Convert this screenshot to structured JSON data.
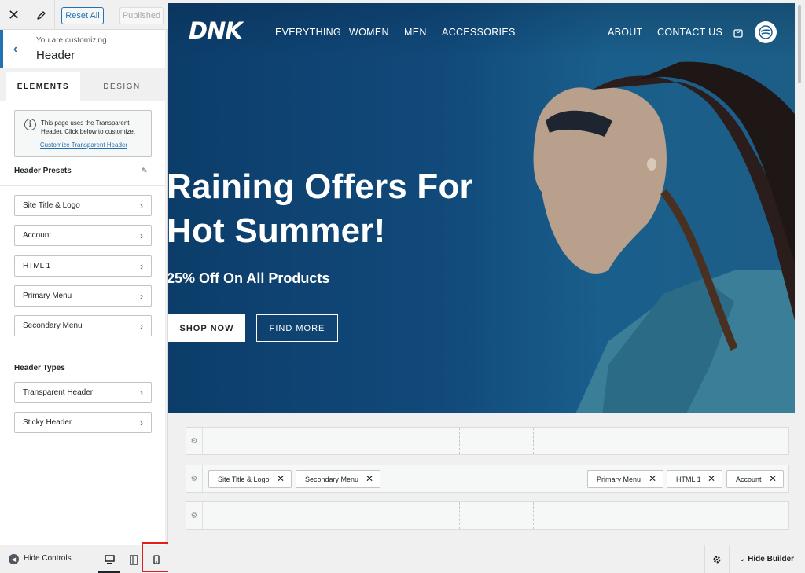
{
  "topbar": {
    "reset_label": "Reset All",
    "published_label": "Published"
  },
  "crumb": {
    "subtitle": "You are customizing",
    "title": "Header"
  },
  "tabs": [
    {
      "label": "ELEMENTS"
    },
    {
      "label": "DESIGN"
    }
  ],
  "notice": {
    "text": "This page uses the Transparent Header. Click below to customize.",
    "link": "Customize Transparent Header"
  },
  "presets": {
    "title": "Header Presets",
    "items": [
      {
        "label": "Site Title & Logo"
      },
      {
        "label": "Account"
      },
      {
        "label": "HTML 1"
      },
      {
        "label": "Primary Menu"
      },
      {
        "label": "Secondary Menu"
      }
    ]
  },
  "types": {
    "title": "Header Types",
    "items": [
      {
        "label": "Transparent Header"
      },
      {
        "label": "Sticky Header"
      }
    ]
  },
  "footer": {
    "hide_controls": "Hide Controls",
    "active_device": "desktop"
  },
  "site": {
    "logo": "DNK",
    "nav_left": [
      "EVERYTHING",
      "WOMEN",
      "MEN",
      "ACCESSORIES"
    ],
    "nav_right": [
      "ABOUT",
      "CONTACT US"
    ],
    "headline_1": "Raining Offers For",
    "headline_2": "Hot Summer!",
    "subheadline": "25% Off On All Products",
    "btn_shop": "SHOP NOW",
    "btn_find": "FIND MORE"
  },
  "builder": {
    "middle_left": [
      "Site Title & Logo",
      "Secondary Menu"
    ],
    "middle_right": [
      "Primary Menu",
      "HTML 1",
      "Account"
    ],
    "hide_builder": "Hide Builder"
  },
  "colors": {
    "accent": "#2271b1",
    "hero": "#114a7b",
    "highlight": "#e31d1d"
  }
}
